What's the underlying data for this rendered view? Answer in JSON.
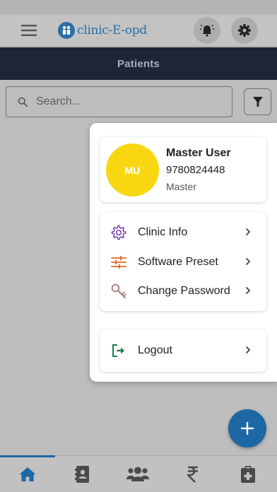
{
  "app": {
    "logo_text": "clinic-E-opd"
  },
  "header": {
    "title": "Patients"
  },
  "search": {
    "placeholder": "Search..."
  },
  "profile": {
    "initials": "MU",
    "name": "Master User",
    "phone": "9780824448",
    "role": "Master"
  },
  "menu": {
    "items": [
      {
        "label": "Clinic Info",
        "icon": "gear-outline-icon"
      },
      {
        "label": "Software Preset",
        "icon": "sliders-icon"
      },
      {
        "label": "Change Password",
        "icon": "key-icon"
      }
    ],
    "logout": {
      "label": "Logout",
      "icon": "logout-icon"
    }
  },
  "bottom_nav": {
    "items": [
      {
        "icon": "home-icon",
        "active": true
      },
      {
        "icon": "contacts-icon",
        "active": false
      },
      {
        "icon": "users-icon",
        "active": false
      },
      {
        "icon": "rupee-icon",
        "active": false
      },
      {
        "icon": "medical-file-icon",
        "active": false
      }
    ]
  },
  "colors": {
    "primary": "#1c67a4",
    "title_bar": "#1e2535",
    "avatar": "#f8d711",
    "gear_icon": "#7b3fb8",
    "sliders_icon": "#e0681e",
    "key_icon": "#b58a8a",
    "logout_icon": "#1e7d4a"
  }
}
